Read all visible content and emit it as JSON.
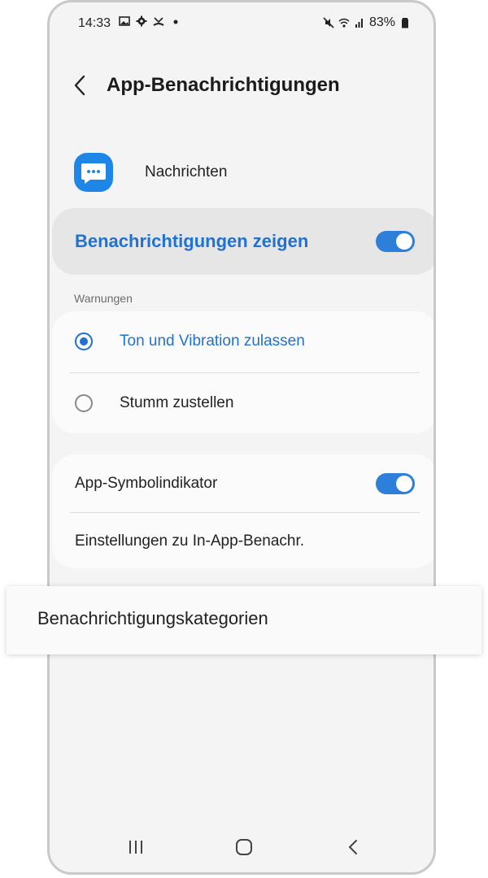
{
  "status_bar": {
    "time": "14:33",
    "battery": "83%",
    "left_icons": [
      "image-icon",
      "gear-icon",
      "missed-call-icon",
      "dot-icon"
    ],
    "right_icons": [
      "mute-icon",
      "wifi-icon",
      "signal-icon",
      "battery-icon"
    ]
  },
  "header": {
    "title": "App-Benachrichtigungen",
    "back_icon": "chevron-left-icon"
  },
  "app": {
    "name": "Nachrichten",
    "icon": "chat-bubble-icon",
    "icon_color": "#1e86e6"
  },
  "show_notifications": {
    "label": "Benachrichtigungen zeigen",
    "enabled": true
  },
  "alerts": {
    "section_label": "Warnungen",
    "options": [
      {
        "label": "Ton und Vibration zulassen",
        "selected": true
      },
      {
        "label": "Stumm zustellen",
        "selected": false
      }
    ]
  },
  "settings": {
    "badge_label": "App-Symbolindikator",
    "badge_enabled": true,
    "in_app_label": "Einstellungen zu In-App-Benachr."
  },
  "categories": {
    "label": "Benachrichtigungskategorien"
  },
  "nav_bar": {
    "items": [
      "recents-icon",
      "home-icon",
      "back-icon"
    ]
  },
  "colors": {
    "accent": "#1f72d1",
    "toggle": "#2e7fd9",
    "background": "#f4f4f4"
  }
}
